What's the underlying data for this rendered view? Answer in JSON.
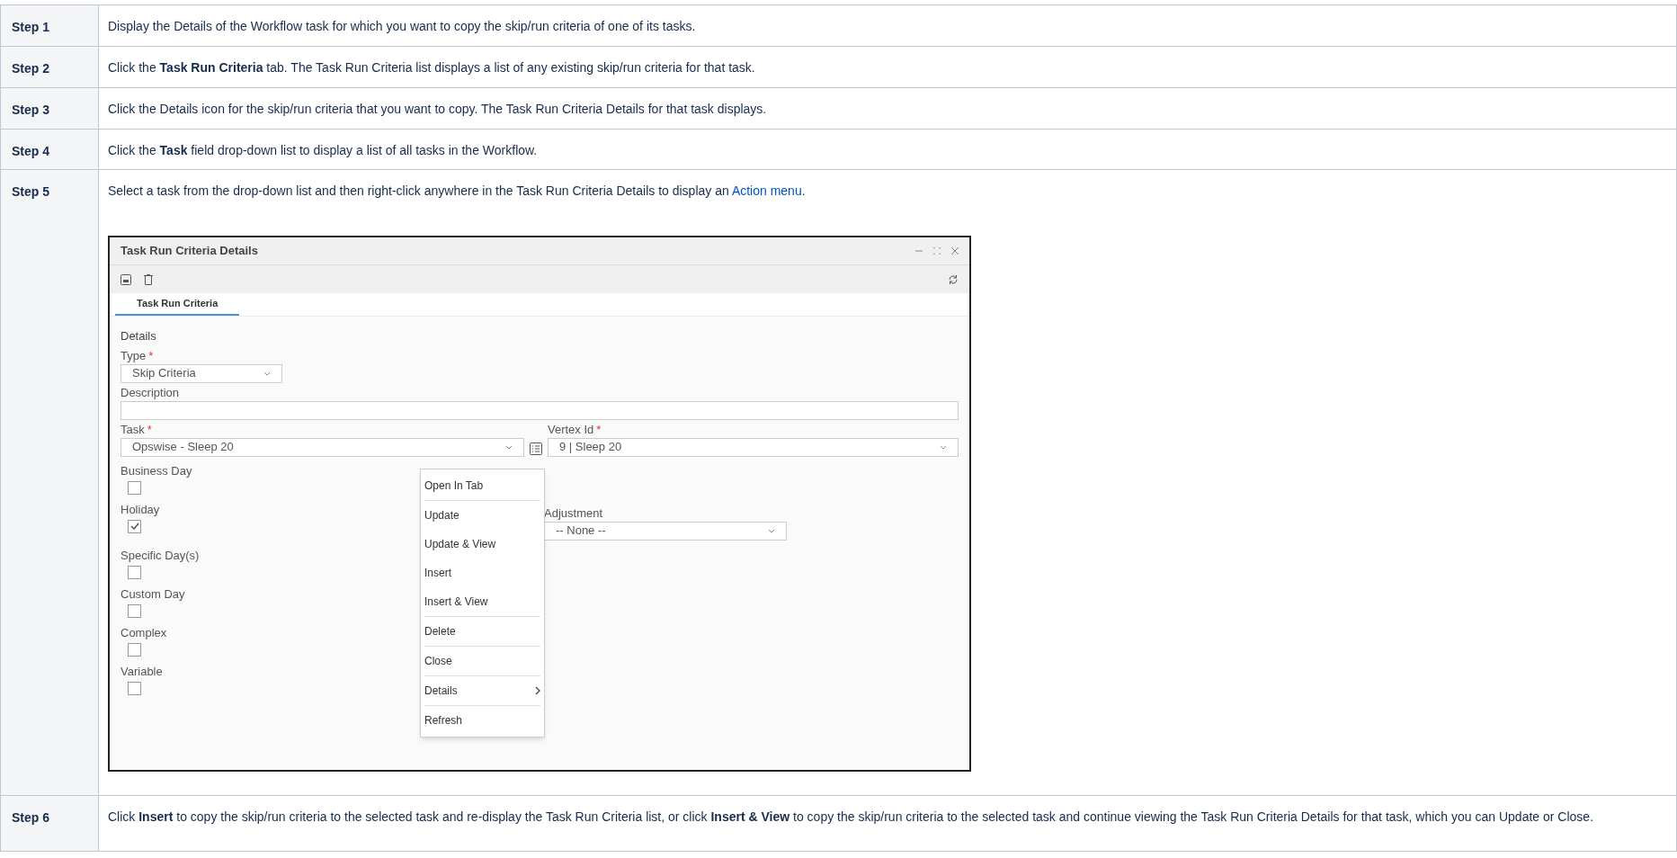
{
  "steps": [
    {
      "label": "Step 1",
      "text": "Display the Details of the Workflow task for which you want to copy the skip/run criteria of one of its tasks."
    },
    {
      "label": "Step 2",
      "text": "Click the **Task Run Criteria** tab. The Task Run Criteria list displays a list of any existing skip/run criteria for that task."
    },
    {
      "label": "Step 3",
      "text": "Click the Details icon for the skip/run criteria that you want to copy. The Task Run Criteria Details for that task displays."
    },
    {
      "label": "Step 4",
      "text": "Click the **Task** field drop-down list to display a list of all tasks in the Workflow."
    },
    {
      "label": "Step 5",
      "text": "Select a task from the drop-down list and then right-click anywhere in the Task Run Criteria Details to display an",
      "link": "Action menu",
      "text_after": ".",
      "screenshot": {
        "title": "Task Run Criteria Details",
        "tabs": [
          {
            "label": "Task Run Criteria",
            "selected": true
          }
        ],
        "section": "Details",
        "type": {
          "label": "Type",
          "required_mark": "*",
          "value": "Skip Criteria"
        },
        "description": {
          "label": "Description"
        },
        "task": {
          "label": "Task",
          "required_mark": "*",
          "value": "Opswise - Sleep 20"
        },
        "vertex": {
          "label": "Vertex Id",
          "required_mark": "*",
          "value": "9 | Sleep 20"
        },
        "checkboxes": [
          {
            "label": "Business Day",
            "checked": false
          },
          {
            "label": "Holiday",
            "checked": true
          },
          {
            "label": "Specific Day(s)",
            "checked": false
          },
          {
            "label": "Custom Day",
            "checked": false
          },
          {
            "label": "Complex",
            "checked": false
          },
          {
            "label": "Variable",
            "checked": false
          }
        ],
        "adjustment": {
          "label": "Adjustment",
          "value": "-- None --"
        },
        "menu": [
          [
            {
              "label": "Open In Tab",
              "submenu": false
            }
          ],
          [
            {
              "label": "Update",
              "submenu": false
            },
            {
              "label": "Update & View",
              "submenu": false
            },
            {
              "label": "Insert",
              "submenu": false
            },
            {
              "label": "Insert & View",
              "submenu": false
            }
          ],
          [
            {
              "label": "Delete",
              "submenu": false
            }
          ],
          [
            {
              "label": "Close",
              "submenu": false
            }
          ],
          [
            {
              "label": "Details",
              "submenu": true
            }
          ],
          [
            {
              "label": "Refresh",
              "submenu": false
            }
          ]
        ]
      }
    },
    {
      "label": "Step 6",
      "text": "Click **Insert** to copy the skip/run criteria to the selected task and re-display the Task Run Criteria list, or click **Insert & View** to copy the skip/run criteria to the selected task and continue viewing the Task Run Criteria Details for that task, which you can Update or Close."
    }
  ]
}
